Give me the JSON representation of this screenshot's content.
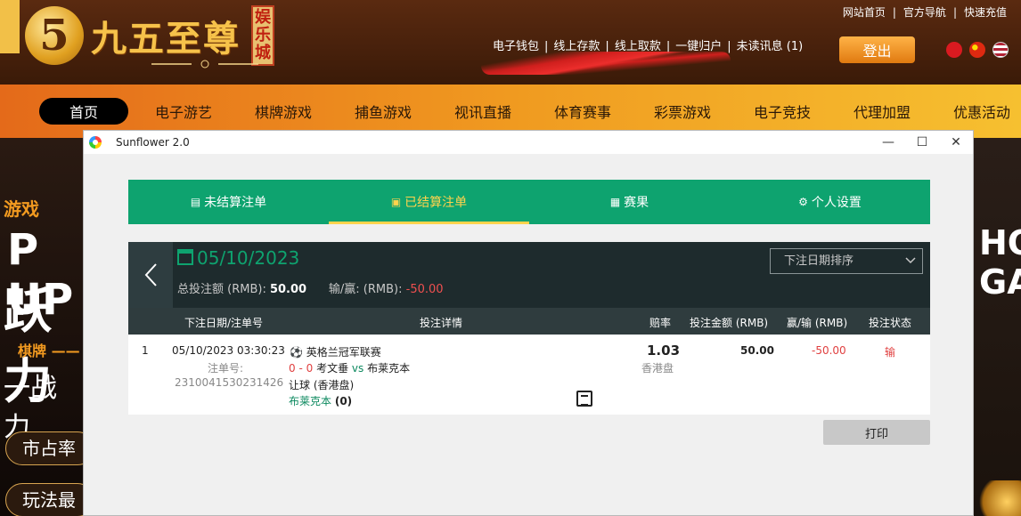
{
  "site": {
    "brand_digit": "5",
    "brand_name": "九五至尊",
    "brand_badge": "娱乐城"
  },
  "toplinks": [
    "网站首页",
    "|",
    "官方导航",
    "|",
    "快速充值"
  ],
  "acctlinks": [
    "电子钱包",
    "|",
    "线上存款",
    "|",
    "线上取款",
    "|",
    "一键归户",
    "|",
    "未读讯息 (1)"
  ],
  "logout_label": "登出",
  "nav": [
    "首页",
    "电子游艺",
    "棋牌游戏",
    "捕鱼游戏",
    "视讯直播",
    "体育赛事",
    "彩票游戏",
    "电子竞技",
    "代理加盟",
    "优惠活动"
  ],
  "bg_left": {
    "t1": "游戏",
    "t2": "P UP",
    "t3": "跃力",
    "t4": "棋牌 ——",
    "t5": "一战 力",
    "pill1": "市占率",
    "pill2": "玩法最"
  },
  "bg_right": {
    "t1": "HO",
    "t2": "GA"
  },
  "window": {
    "title": "Sunflower 2.0",
    "min": "—",
    "max": "☐",
    "close": "✕"
  },
  "tabs": [
    {
      "icon": "▤",
      "label": "未结算注单"
    },
    {
      "icon": "▣",
      "label": "已结算注单"
    },
    {
      "icon": "▦",
      "label": "赛果"
    },
    {
      "icon": "⚙",
      "label": "个人设置"
    }
  ],
  "summary": {
    "date": "05/10/2023",
    "total_label": "总投注额 (RMB):",
    "total_value": "50.00",
    "winloss_label": "输/赢: (RMB):",
    "winloss_value": "-50.00",
    "sort_label": "下注日期排序"
  },
  "table": {
    "headers": [
      "下注日期/注单号",
      "投注详情",
      "赔率",
      "投注金额 (RMB)",
      "赢/输 (RMB)",
      "投注状态"
    ],
    "rows": [
      {
        "index": "1",
        "datetime": "05/10/2023 03:30:23",
        "ticket_label": "注单号:",
        "ticket_no": "2310041530231426",
        "league": "英格兰冠军联赛",
        "score": "0 - 0",
        "home": "考文垂",
        "vs": "vs",
        "away": "布莱克本",
        "market": "让球 (香港盘)",
        "selection": "布莱克本",
        "handicap": "(0)",
        "odds": "1.03",
        "odds_type": "香港盘",
        "stake": "50.00",
        "winloss": "-50.00",
        "status": "输"
      }
    ]
  },
  "print_label": "打印",
  "colors": {
    "primary_green": "#0ea36f",
    "accent_yellow": "#ffd34d",
    "loss_red": "#e04040",
    "panel_dark": "#1e2b2d"
  }
}
